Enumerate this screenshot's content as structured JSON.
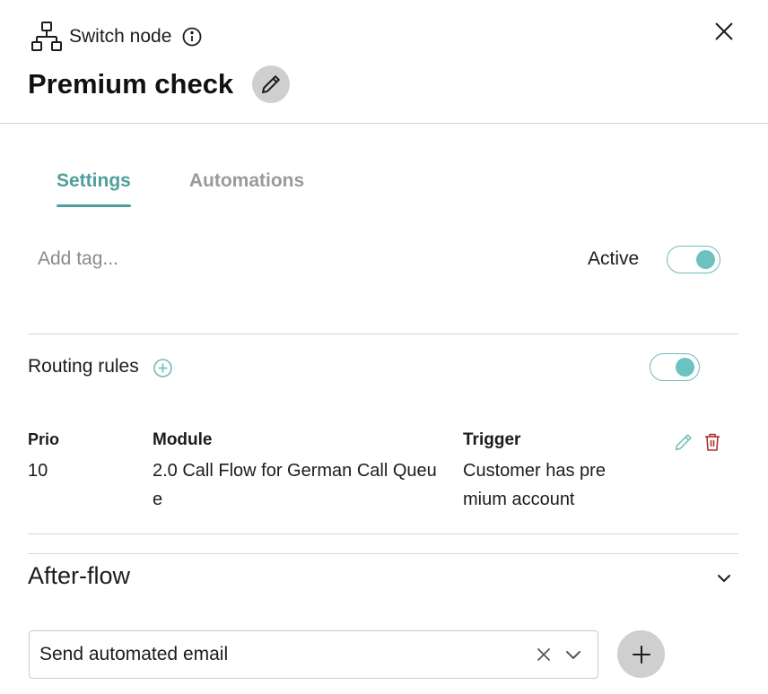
{
  "header": {
    "node_type": "Switch node",
    "title": "Premium check",
    "icons": {
      "node_type_icon": "sitemap-icon",
      "info": "info-icon",
      "edit": "pencil-icon",
      "close": "close-icon"
    }
  },
  "tabs": [
    {
      "label": "Settings",
      "active": true
    },
    {
      "label": "Automations",
      "active": false
    }
  ],
  "tags": {
    "placeholder": "Add tag..."
  },
  "status": {
    "label": "Active",
    "enabled": true
  },
  "routing": {
    "label": "Routing rules",
    "enabled": true,
    "columns": {
      "prio": "Prio",
      "module": "Module",
      "trigger": "Trigger"
    },
    "rules": [
      {
        "prio": "10",
        "module": "2.0 Call Flow for German Call Queue",
        "trigger": "Customer has premium account"
      }
    ]
  },
  "after_flow": {
    "title": "After-flow",
    "expanded": true,
    "selected": "Send automated email"
  },
  "colors": {
    "accent": "#4f9e9e",
    "toggle_knob": "#6cc1c1",
    "delete": "#b03030",
    "muted_tab": "#9a9a9a"
  }
}
